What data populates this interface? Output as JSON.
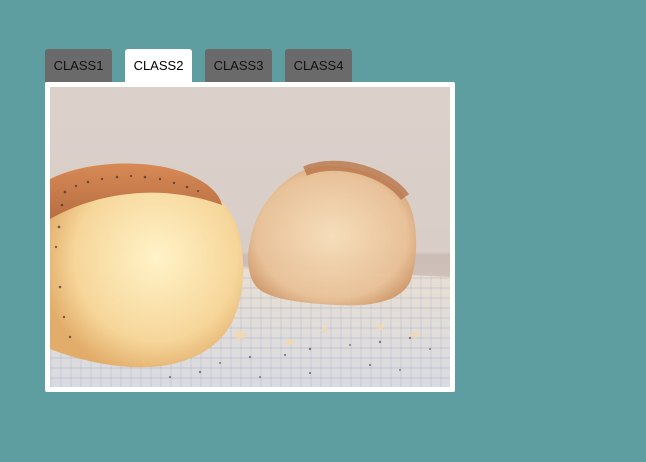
{
  "tabs": [
    {
      "label": "CLASS1",
      "active": false
    },
    {
      "label": "CLASS2",
      "active": true
    },
    {
      "label": "CLASS3",
      "active": false
    },
    {
      "label": "CLASS4",
      "active": false
    }
  ],
  "colors": {
    "background": "#5f9ea0",
    "tab_inactive": "#6a6a6a",
    "tab_active": "#ffffff",
    "panel": "#ffffff"
  },
  "content": {
    "image_subject": "bread-loaf-photo"
  }
}
